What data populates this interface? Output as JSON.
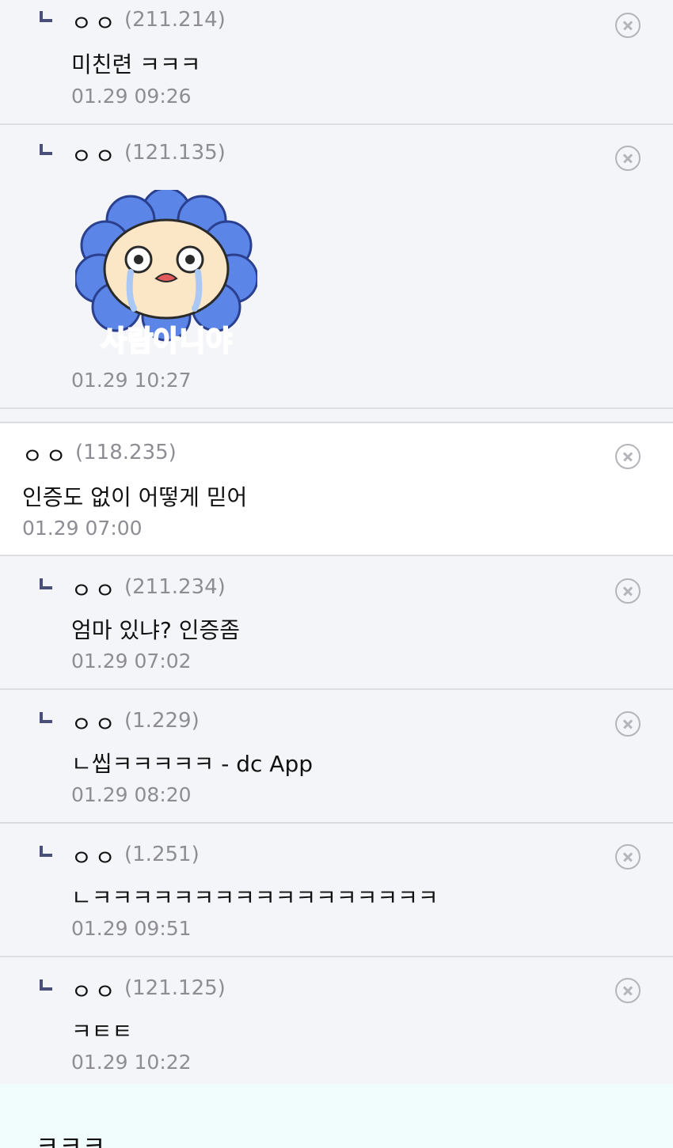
{
  "comments": [
    {
      "nick": "ㅇㅇ",
      "ip": "(211.214)",
      "text": "미친련 ㅋㅋㅋ",
      "date": "01.29 09:26"
    },
    {
      "nick": "ㅇㅇ",
      "ip": "(121.135)",
      "sticker_text": "사람아니야",
      "date": "01.29 10:27"
    },
    {
      "nick": "ㅇㅇ",
      "ip": "(118.235)",
      "text": "인증도 없이 어떻게 믿어",
      "date": "01.29 07:00"
    },
    {
      "nick": "ㅇㅇ",
      "ip": "(211.234)",
      "text": "엄마 있냐? 인증좀",
      "date": "01.29 07:02"
    },
    {
      "nick": "ㅇㅇ",
      "ip": "(1.229)",
      "text": "ㄴ씹ㅋㅋㅋㅋㅋ - dc App",
      "date": "01.29 08:20"
    },
    {
      "nick": "ㅇㅇ",
      "ip": "(1.251)",
      "text": "ㄴㅋㅋㅋㅋㅋㅋㅋㅋㅋㅋㅋㅋㅋㅋㅋㅋㅋ",
      "date": "01.29 09:51"
    },
    {
      "nick": "ㅇㅇ",
      "ip": "(121.125)",
      "text": "ㅋㅌㅌ",
      "date": "01.29 10:22"
    }
  ],
  "footer": {
    "text": "ㅋㅋㅋ"
  },
  "colors": {
    "reply_bg": "#f4f5f9",
    "top_bg": "#ffffff",
    "divider": "#dcdde3",
    "meta_text": "#8d8d93",
    "reply_mark": "#4a4f7a",
    "footer_bg": "#f1fdfd"
  },
  "icons": {
    "reply": "reply-arrow-icon",
    "delete": "close-circle-icon"
  }
}
